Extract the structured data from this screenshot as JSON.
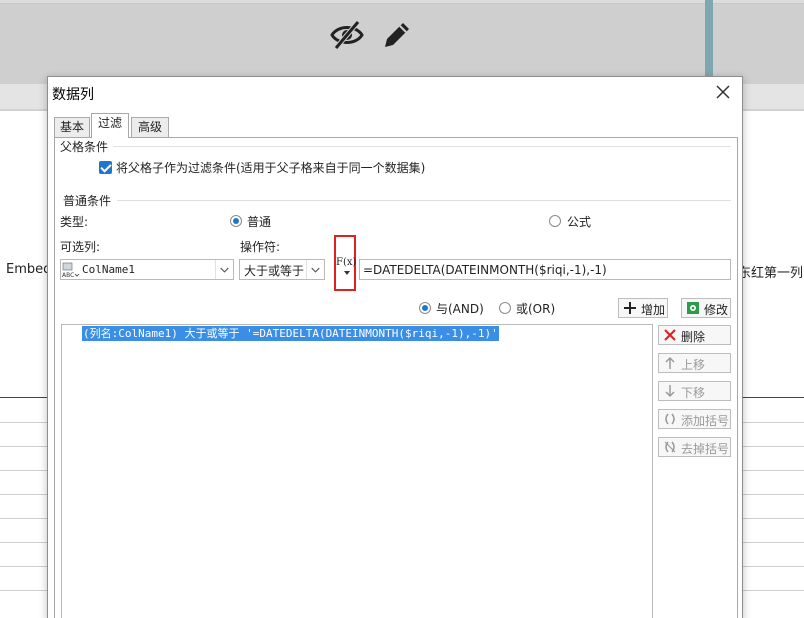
{
  "background": {
    "left_text": "Embedd",
    "right_text": "东红第一列"
  },
  "dialog": {
    "title": "数据列",
    "tabs": [
      {
        "label": "基本"
      },
      {
        "label": "过滤"
      },
      {
        "label": "高级"
      }
    ],
    "parent_condition": {
      "section_title": "父格条件",
      "checkbox_label": "将父格子作为过滤条件(适用于父子格来自于同一个数据集)",
      "checked": true
    },
    "normal_condition": {
      "section_title": "普通条件",
      "type_label": "类型:",
      "type_options": [
        {
          "label": "普通",
          "selected": true
        },
        {
          "label": "公式",
          "selected": false
        }
      ],
      "column_label": "可选列:",
      "operator_label": "操作符:",
      "column_value": "ColName1",
      "operator_value": "大于或等于",
      "formula_value": "=DATEDELTA(DATEINMONTH($riqi,-1),-1)",
      "fx_label": "F(x)"
    },
    "logic": [
      {
        "label": "与(AND)",
        "selected": true
      },
      {
        "label": "或(OR)",
        "selected": false
      }
    ],
    "buttons": {
      "add": "增加",
      "modify": "修改",
      "delete": "删除",
      "move_up": "上移",
      "move_down": "下移",
      "add_bracket": "添加括号",
      "remove_bracket": "去掉括号"
    },
    "conditions": [
      "(列名:ColName1) 大于或等于 '=DATEDELTA(DATEINMONTH($riqi,-1),-1)'"
    ]
  }
}
